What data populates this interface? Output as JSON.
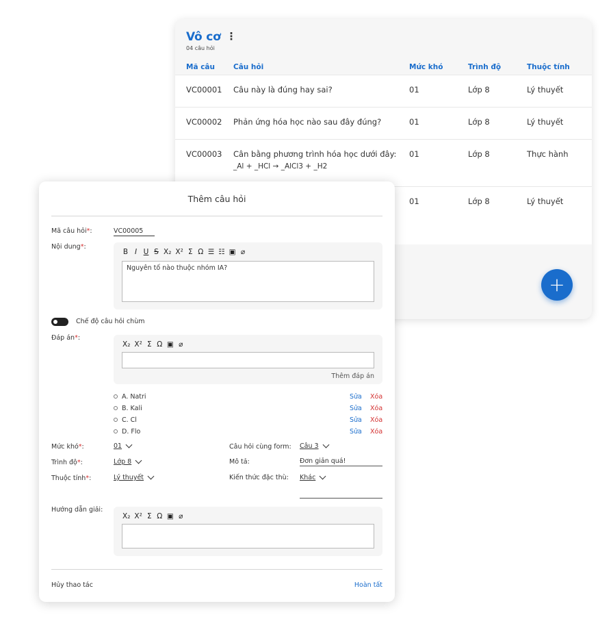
{
  "list": {
    "title": "Vô cơ",
    "subtitle": "04 câu hỏi",
    "columns": [
      "Mã câu",
      "Câu hỏi",
      "Mức khó",
      "Trình độ",
      "Thuộc tính"
    ],
    "rows": [
      {
        "code": "VC00001",
        "question": "Câu này là đúng hay sai?",
        "difficulty": "01",
        "level": "Lớp 8",
        "type": "Lý thuyết"
      },
      {
        "code": "VC00002",
        "question": "Phản ứng hóa học nào sau đây đúng?",
        "difficulty": "01",
        "level": "Lớp 8",
        "type": "Lý thuyết"
      },
      {
        "code": "VC00003",
        "question": "Cân bằng phương trình hóa học dưới đây:",
        "equation": "_Al + _HCl → _AlCl3 + _H2",
        "difficulty": "01",
        "level": "Lớp 8",
        "type": "Thực hành"
      },
      {
        "code": "",
        "question": "",
        "difficulty": "01",
        "level": "Lớp 8",
        "type": "Lý thuyết"
      }
    ]
  },
  "dialog": {
    "title": "Thêm câu hỏi",
    "code_label": "Mã câu hỏi",
    "code_value": "VC00005",
    "content_label": "Nội dung",
    "content_value": "Nguyên tố nào thuộc nhóm IA?",
    "toolbar_full": [
      "B",
      "I",
      "U",
      "S",
      "X₂",
      "X²",
      "Σ",
      "Ω",
      "☰",
      "☷",
      "▣",
      "⌀"
    ],
    "toolbar_short": [
      "X₂",
      "X²",
      "Σ",
      "Ω",
      "▣",
      "⌀"
    ],
    "cluster_mode_label": "Chế độ câu hỏi chùm",
    "answer_label": "Đáp án",
    "add_answer_label": "Thêm đáp án",
    "answers": [
      {
        "text": "A. Natri"
      },
      {
        "text": "B. Kali"
      },
      {
        "text": "C. Cl"
      },
      {
        "text": "D. Flo"
      }
    ],
    "edit_label": "Sửa",
    "delete_label": "Xóa",
    "difficulty_label": "Mức khó",
    "difficulty_value": "01",
    "level_label": "Trình độ",
    "level_value": "Lớp 8",
    "type_label": "Thuộc tính",
    "type_value": "Lý thuyết",
    "same_form_label": "Câu hỏi cùng form:",
    "same_form_value": "Câu 3",
    "desc_label": "Mô tả:",
    "desc_value": "Đơn giản quá!",
    "knowledge_label": "Kiến thức đặc thù:",
    "knowledge_value": "Khác",
    "guide_label": "Hướng dẫn giải:",
    "cancel_label": "Hủy thao tác",
    "done_label": "Hoàn tất"
  }
}
